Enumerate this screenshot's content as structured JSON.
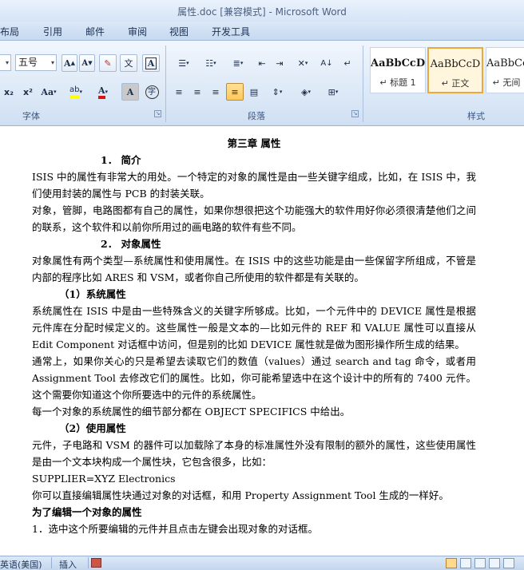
{
  "window": {
    "title": "属性.doc [兼容模式] - Microsoft Word"
  },
  "ribbon_tabs": [
    "布局",
    "引用",
    "邮件",
    "审阅",
    "视图",
    "开发工具"
  ],
  "font_group": {
    "label": "字体",
    "font_size": "五号",
    "grow_font": "A",
    "shrink_font": "A",
    "change_case": "Aa",
    "char_shading": "A",
    "subscript": "x₂",
    "superscript": "x²",
    "highlight_letters": "ab",
    "font_color": "A",
    "enclose_char": "字"
  },
  "paragraph_group": {
    "label": "段落"
  },
  "styles_group": {
    "label": "样式",
    "styles": [
      {
        "sample": "AaBbCcD",
        "name": "↵ 标题 1"
      },
      {
        "sample": "AaBbCcD",
        "name": "↵ 正文"
      },
      {
        "sample": "AaBbCc",
        "name": "↵ 无间"
      }
    ]
  },
  "document": {
    "lines": [
      {
        "style": "center",
        "text": "第三章 属性"
      },
      {
        "style": "h1",
        "text": "1．  简介"
      },
      {
        "style": "p",
        "text": "ISIS 中的属性有非常大的用处。一个特定的对象的属性是由一些关键字组成，比如，在 ISIS 中，我们使用封装的属性与 PCB 的封装关联。"
      },
      {
        "style": "p",
        "text": "对象，管脚，电路图都有自己的属性，如果你想很把这个功能强大的软件用好你必须很清楚他们之间的联系，这个软件和以前你所用过的画电路的软件有些不同。"
      },
      {
        "style": "h1",
        "text": "2．  对象属性"
      },
      {
        "style": "p",
        "text": "对象属性有两个类型—系统属性和使用属性。在 ISIS 中的这些功能是由一些保留字所组成，不管是内部的程序比如 ARES 和 VSM，或者你自己所使用的软件都是有关联的。"
      },
      {
        "style": "h2",
        "text": "（1）系统属性"
      },
      {
        "style": "p",
        "text": "系统属性在 ISIS 中是由一些特殊含义的关键字所够成。比如，一个元件中的 DEVICE 属性是根据元件库在分配时候定义的。这些属性一般是文本的—比如元件的 REF 和 VALUE 属性可以直接从 Edit Component 对话框中访问，但是别的比如 DEVICE 属性就是做为图形操作所生成的结果。"
      },
      {
        "style": "p",
        "text": "通常上，如果你关心的只是希望去读取它们的数值（values）通过 search and tag 命令，或者用 Assignment Tool 去修改它们的属性。比如，你可能希望选中在这个设计中的所有的 7400 元件。这个需要你知道这个你所要选中的元件的系统属性。"
      },
      {
        "style": "p",
        "text": "每一个对象的系统属性的细节部分都在 OBJECT SPECIFICS 中给出。"
      },
      {
        "style": "h2",
        "text": "（2）使用属性"
      },
      {
        "style": "p",
        "text": "元件，子电路和 VSM 的器件可以加载除了本身的标准属性外没有限制的额外的属性，这些使用属性是由一个文本块构成一个属性块，它包含很多，比如："
      },
      {
        "style": "p",
        "text": "SUPPLIER=XYZ Electronics"
      },
      {
        "style": "p",
        "text": "你可以直接编辑属性块通过对象的对话框，和用 Property Assignment Tool 生成的一样好。"
      },
      {
        "style": "bold",
        "text": "为了编辑一个对象的属性"
      },
      {
        "style": "p",
        "text": "1．选中这个所要编辑的元件并且点击左键会出现对象的对话框。"
      }
    ]
  },
  "status_bar": {
    "language": "英语(美国)",
    "mode": "插入"
  }
}
